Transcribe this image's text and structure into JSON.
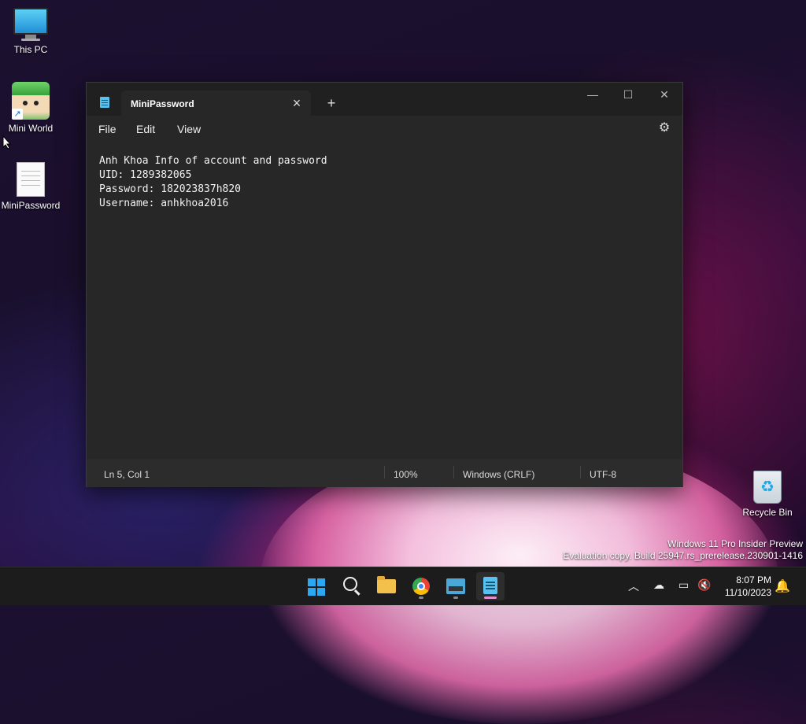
{
  "desktop": {
    "icons": [
      {
        "label": "This PC"
      },
      {
        "label": "Mini World"
      },
      {
        "label": "MiniPassword"
      },
      {
        "label": "Recycle Bin"
      }
    ],
    "watermark": {
      "line1": "Windows 11 Pro Insider Preview",
      "line2": "Evaluation copy. Build 25947.rs_prerelease.230901-1416"
    }
  },
  "notepad": {
    "tab_title": "MiniPassword",
    "menu": {
      "file": "File",
      "edit": "Edit",
      "view": "View"
    },
    "content": [
      "Anh Khoa Info of account and password",
      "UID: 1289382065",
      "Password: 182023837h820",
      "Username: anhkhoa2016"
    ],
    "status": {
      "position": "Ln 5, Col 1",
      "zoom": "100%",
      "line_ending": "Windows (CRLF)",
      "encoding": "UTF-8"
    }
  },
  "taskbar": {
    "time": "8:07 PM",
    "date": "11/10/2023"
  },
  "colors": {
    "accent": "#e48fd0",
    "window_bg": "#272727",
    "taskbar_bg": "#1c1c1c"
  }
}
